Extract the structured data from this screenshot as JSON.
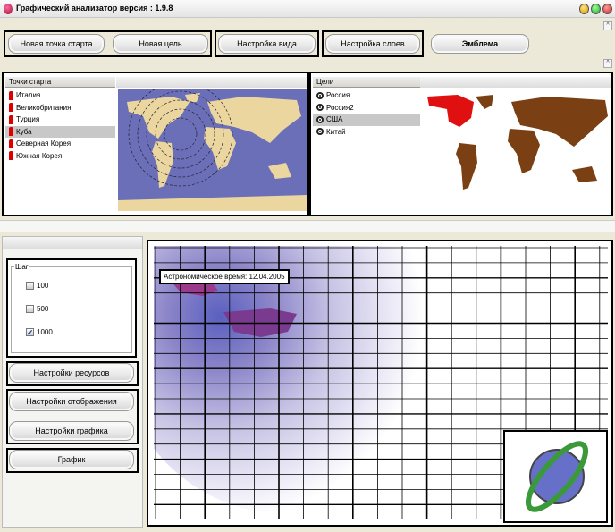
{
  "window": {
    "title": "Графический анализатор версия : 1.9.8"
  },
  "toolbar": {
    "buttons": [
      "Новая точка старта",
      "Новая цель",
      "Настройка вида",
      "Настройка слоев",
      "Эмблема"
    ]
  },
  "start_points": {
    "header": "Точки старта",
    "items": [
      "Италия",
      "Великобритания",
      "Турция",
      "Куба",
      "Северная Корея",
      "Южная Корея"
    ],
    "selected": 3
  },
  "targets": {
    "header": "Цели",
    "items": [
      "Россия",
      "Россия2",
      "США",
      "Китай"
    ],
    "selected": 2
  },
  "step": {
    "label": "Шаг",
    "options": [
      {
        "label": "100",
        "checked": false
      },
      {
        "label": "500",
        "checked": false
      },
      {
        "label": "1000",
        "checked": true
      }
    ]
  },
  "sidebar": {
    "resources": "Настройки ресурсов",
    "display": "Настройки отображения",
    "graph_settings": "Настройки графика",
    "graph": "График"
  },
  "chart": {
    "time_label": "Астрономическое время: 12.04.2005"
  },
  "colors": {
    "ocean": "#6b6fb8",
    "land": "#ecd6a0",
    "target_land": "#7a3f12",
    "target_selected": "#e01010"
  }
}
